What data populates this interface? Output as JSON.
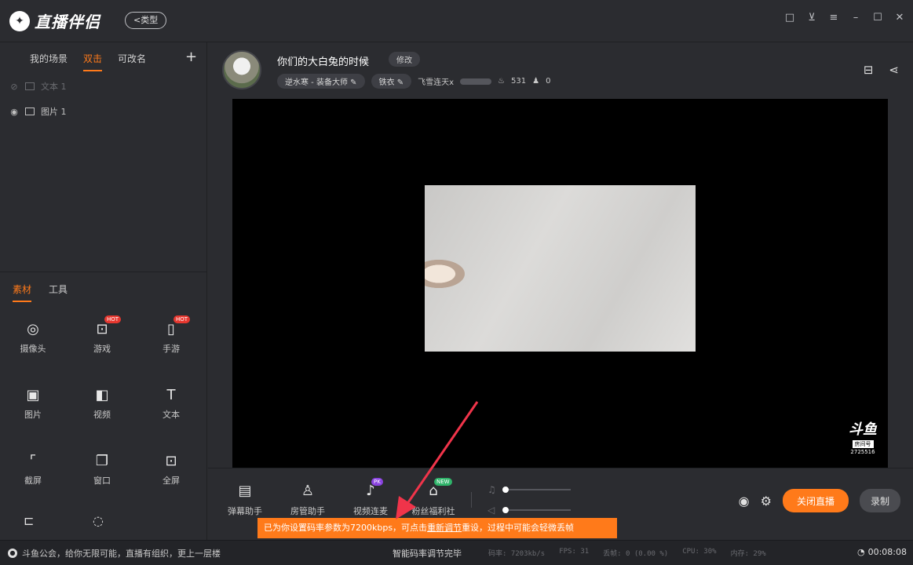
{
  "app": {
    "name": "直播伴侣",
    "type_label": "<类型"
  },
  "window_controls": [
    "□",
    "⊻",
    "≡",
    "–",
    "☐",
    "✕"
  ],
  "scenes": {
    "tabs": [
      {
        "label": "我的场景",
        "active": false
      },
      {
        "label": "双击",
        "active": true
      },
      {
        "label": "可改名",
        "active": false
      }
    ],
    "add_label": "+",
    "layers": [
      {
        "label": "文本 1",
        "visible": false
      },
      {
        "label": "图片 1",
        "visible": true
      }
    ]
  },
  "materials": {
    "tabs": [
      {
        "label": "素材",
        "active": true
      },
      {
        "label": "工具",
        "active": false
      }
    ],
    "items": [
      {
        "label": "摄像头",
        "icon": "camera-icon",
        "glyph": "◎",
        "badge": ""
      },
      {
        "label": "游戏",
        "icon": "gamepad-icon",
        "glyph": "⊡",
        "badge": "HOT"
      },
      {
        "label": "手游",
        "icon": "phone-icon",
        "glyph": "▯",
        "badge": "HOT"
      },
      {
        "label": "图片",
        "icon": "image-icon",
        "glyph": "▣",
        "badge": ""
      },
      {
        "label": "视频",
        "icon": "video-icon",
        "glyph": "◧",
        "badge": ""
      },
      {
        "label": "文本",
        "icon": "text-icon",
        "glyph": "T",
        "badge": ""
      },
      {
        "label": "截屏",
        "icon": "crop-icon",
        "glyph": "⌜",
        "badge": ""
      },
      {
        "label": "窗口",
        "icon": "window-icon",
        "glyph": "❐",
        "badge": ""
      },
      {
        "label": "全屏",
        "icon": "fullscreen-icon",
        "glyph": "⊡",
        "badge": ""
      }
    ]
  },
  "room": {
    "title": "你们的大白兔的时候",
    "edit_label": "修改",
    "category": "逆水寒 - 装备大师",
    "tag": "铁衣",
    "streamer": "飞雪连天x",
    "heat": "531",
    "viewers": "0"
  },
  "watermark": {
    "logo": "斗鱼",
    "tag": "房间号",
    "room_id": "2725516"
  },
  "toolbar": {
    "items": [
      {
        "label": "弹幕助手",
        "icon": "danmaku-icon",
        "glyph": "▤",
        "badge": ""
      },
      {
        "label": "房管助手",
        "icon": "admin-icon",
        "glyph": "♙",
        "badge": ""
      },
      {
        "label": "视频连麦",
        "icon": "mic-link-icon",
        "glyph": "♪",
        "badge": "PK"
      },
      {
        "label": "粉丝福利社",
        "icon": "gift-icon",
        "glyph": "⌂",
        "badge": "NEW"
      }
    ],
    "mic_level": 0.0,
    "speaker_level": 0.0,
    "live_label": "关闭直播",
    "record_label": "录制"
  },
  "toast": {
    "prefix": "已为你设置码率参数为7200kbps，可点击",
    "link": "重新调节",
    "suffix": "重设，过程中可能会轻微丢帧"
  },
  "status": {
    "notice": "斗鱼公会，给你无限可能，直播有组织，更上一层楼",
    "done": "智能码率调节完毕",
    "bitrate_label": "码率:",
    "bitrate": "7203kb/s",
    "fps_label": "FPS:",
    "fps": "31",
    "drop_label": "丢帧:",
    "drop": "0 (0.00 %)",
    "cpu_label": "CPU:",
    "cpu": "30%",
    "mem_label": "内存:",
    "mem": "29%",
    "time": "00:08:08"
  },
  "colors": {
    "accent": "#ff7a1a",
    "bg": "#2b2c30",
    "preview_bg": "#000000",
    "arrow": "#f0344a"
  }
}
